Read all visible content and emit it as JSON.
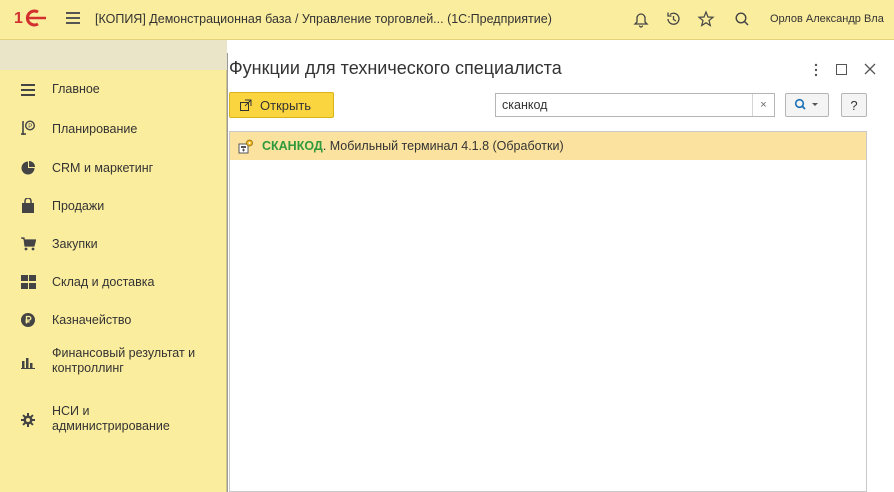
{
  "topbar": {
    "title": "[КОПИЯ] Демонстрационная база / Управление торговлей... (1С:Предприятие)",
    "user": "Орлов Александр Вла"
  },
  "sidebar": {
    "items": [
      {
        "label": "Главное",
        "icon": "menu-lines-icon"
      },
      {
        "label": "Планирование",
        "icon": "planning-icon"
      },
      {
        "label": "CRM и маркетинг",
        "icon": "pie-chart-icon"
      },
      {
        "label": "Продажи",
        "icon": "shopping-bag-icon"
      },
      {
        "label": "Закупки",
        "icon": "cart-icon"
      },
      {
        "label": "Склад и доставка",
        "icon": "warehouse-icon"
      },
      {
        "label": "Казначейство",
        "icon": "ruble-coin-icon"
      },
      {
        "label_line1": "Финансовый результат и",
        "label_line2": "контроллинг",
        "icon": "bar-chart-icon"
      },
      {
        "label_line1": "НСИ и",
        "label_line2": "администрирование",
        "icon": "gear-icon"
      }
    ]
  },
  "panel": {
    "title": "Функции для технического специалиста",
    "open_button": "Открыть",
    "search_value": "сканкод",
    "help_label": "?",
    "clear_label": "×",
    "results": [
      {
        "highlight": "СКАНКОД",
        "rest": ". Мобильный терминал 4.1.8 (Обработки)"
      }
    ]
  },
  "colors": {
    "section_bg": "#fbed9e",
    "primary_button": "#fbd53f",
    "selected_row": "#fbe29f",
    "match_text": "#2e9a3c"
  }
}
